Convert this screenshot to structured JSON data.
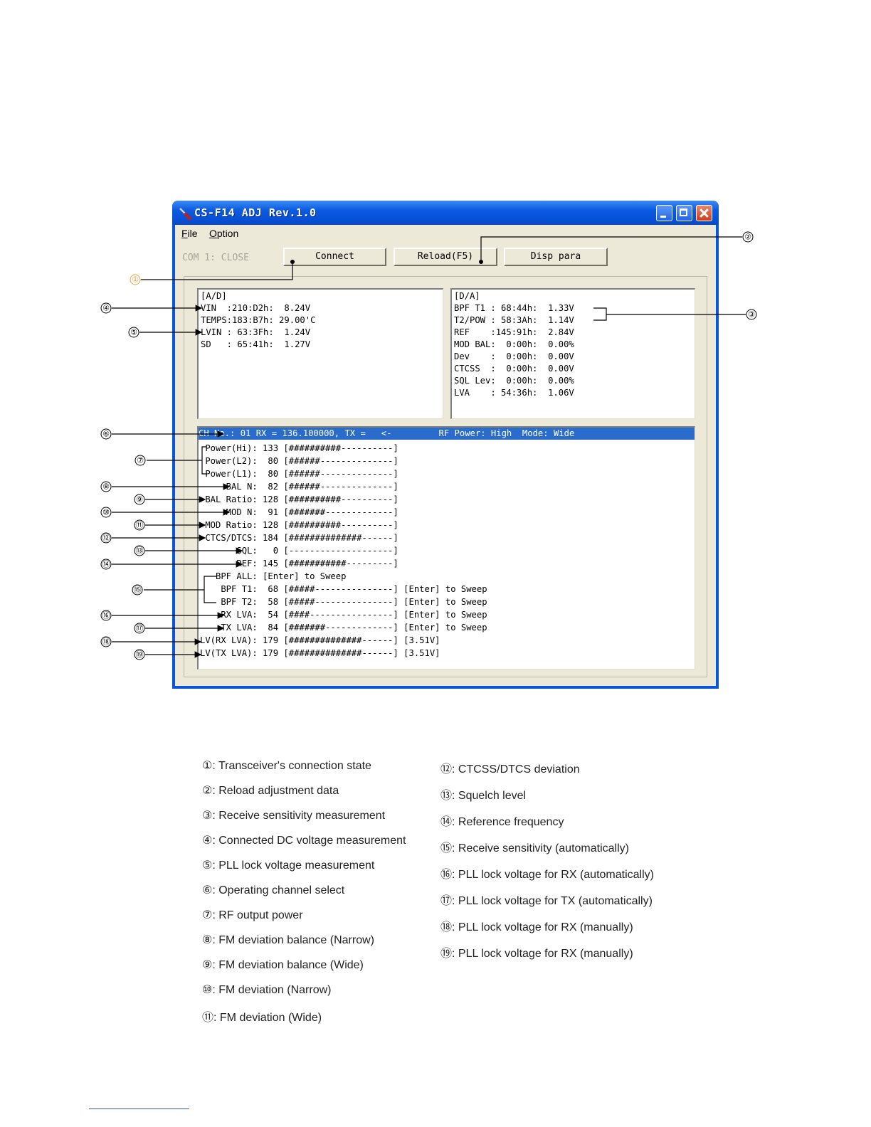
{
  "window": {
    "title": "CS-F14 ADJ Rev.1.0",
    "menu": [
      "File",
      "Option"
    ],
    "com_status": "COM 1: CLOSE",
    "buttons": {
      "connect": "Connect",
      "reload": "Reload(F5)",
      "disp": "Disp para"
    }
  },
  "ad_panel": {
    "lines": [
      "[A/D]",
      "VIN  :210:D2h:  8.24V",
      "TEMPS:183:B7h: 29.00'C",
      "LVIN : 63:3Fh:  1.24V",
      "SD   : 65:41h:  1.27V"
    ]
  },
  "da_panel": {
    "lines": [
      "[D/A]",
      "BPF T1 : 68:44h:  1.33V",
      "T2/POW : 58:3Ah:  1.14V",
      "REF    :145:91h:  2.84V",
      "MOD BAL:  0:00h:  0.00%",
      "Dev    :  0:00h:  0.00V",
      "CTCSS  :  0:00h:  0.00V",
      "SQL Lev:  0:00h:  0.00%",
      "LVA    : 54:36h:  1.06V"
    ]
  },
  "channel_bar": "CH No.: 01 RX = 136.100000, TX =   <-         RF Power: High  Mode: Wide",
  "adjust_rows": [
    " Power(Hi): 133 [##########----------]",
    " Power(L2):  80 [######--------------]",
    " Power(L1):  80 [######--------------]",
    "     BAL N:  82 [######--------------]",
    " BAL Ratio: 128 [##########----------]",
    "     MOD N:  91 [#######-------------]",
    " MOD Ratio: 128 [##########----------]",
    " CTCS/DTCS: 184 [##############------]",
    "       SQL:   0 [--------------------]",
    "       REF: 145 [###########---------]",
    "   BPF ALL: [Enter] to Sweep",
    "    BPF T1:  68 [#####---------------] [Enter] to Sweep",
    "    BPF T2:  58 [#####---------------] [Enter] to Sweep",
    "    RX LVA:  54 [####----------------] [Enter] to Sweep",
    "    TX LVA:  84 [#######-------------] [Enter] to Sweep",
    "LV(RX LVA): 179 [##############------] [3.51V]",
    "LV(TX LVA): 179 [##############------] [3.51V]"
  ],
  "callout_numbers": [
    "①",
    "②",
    "③",
    "④",
    "⑤",
    "⑥",
    "⑦",
    "⑧",
    "⑨",
    "⑩",
    "⑪",
    "⑫",
    "⑬",
    "⑭",
    "⑮",
    "⑯",
    "⑰",
    "⑱",
    "⑲"
  ],
  "legend": [
    {
      "num": "①",
      "text": ": Transceiver's connection state"
    },
    {
      "num": "②",
      "text": ": Reload adjustment data"
    },
    {
      "num": "③",
      "text": ": Receive sensitivity measurement"
    },
    {
      "num": "④",
      "text": ": Connected DC voltage measurement"
    },
    {
      "num": "⑤",
      "text": ": PLL lock voltage measurement"
    },
    {
      "num": "⑥",
      "text": ": Operating channel select"
    },
    {
      "num": "⑦",
      "text": ": RF output power"
    },
    {
      "num": "⑧",
      "text": ": FM deviation balance (Narrow)"
    },
    {
      "num": "⑨",
      "text": ": FM deviation balance (Wide)"
    },
    {
      "num": "⑩",
      "text": ": FM deviation (Narrow)"
    },
    {
      "num": "⑪",
      "text": ": FM deviation (Wide)"
    },
    {
      "num": "⑫",
      "text": ": CTCSS/DTCS deviation"
    },
    {
      "num": "⑬",
      "text": ": Squelch level"
    },
    {
      "num": "⑭",
      "text": ": Reference frequency"
    },
    {
      "num": "⑮",
      "text": ": Receive sensitivity (automatically)"
    },
    {
      "num": "⑯",
      "text": ": PLL lock voltage for RX (automatically)"
    },
    {
      "num": "⑰",
      "text": ": PLL lock voltage for TX (automatically)"
    },
    {
      "num": "⑱",
      "text": ": PLL lock voltage for RX (manually)"
    },
    {
      "num": "⑲",
      "text": ": PLL lock voltage for RX (manually)"
    }
  ]
}
